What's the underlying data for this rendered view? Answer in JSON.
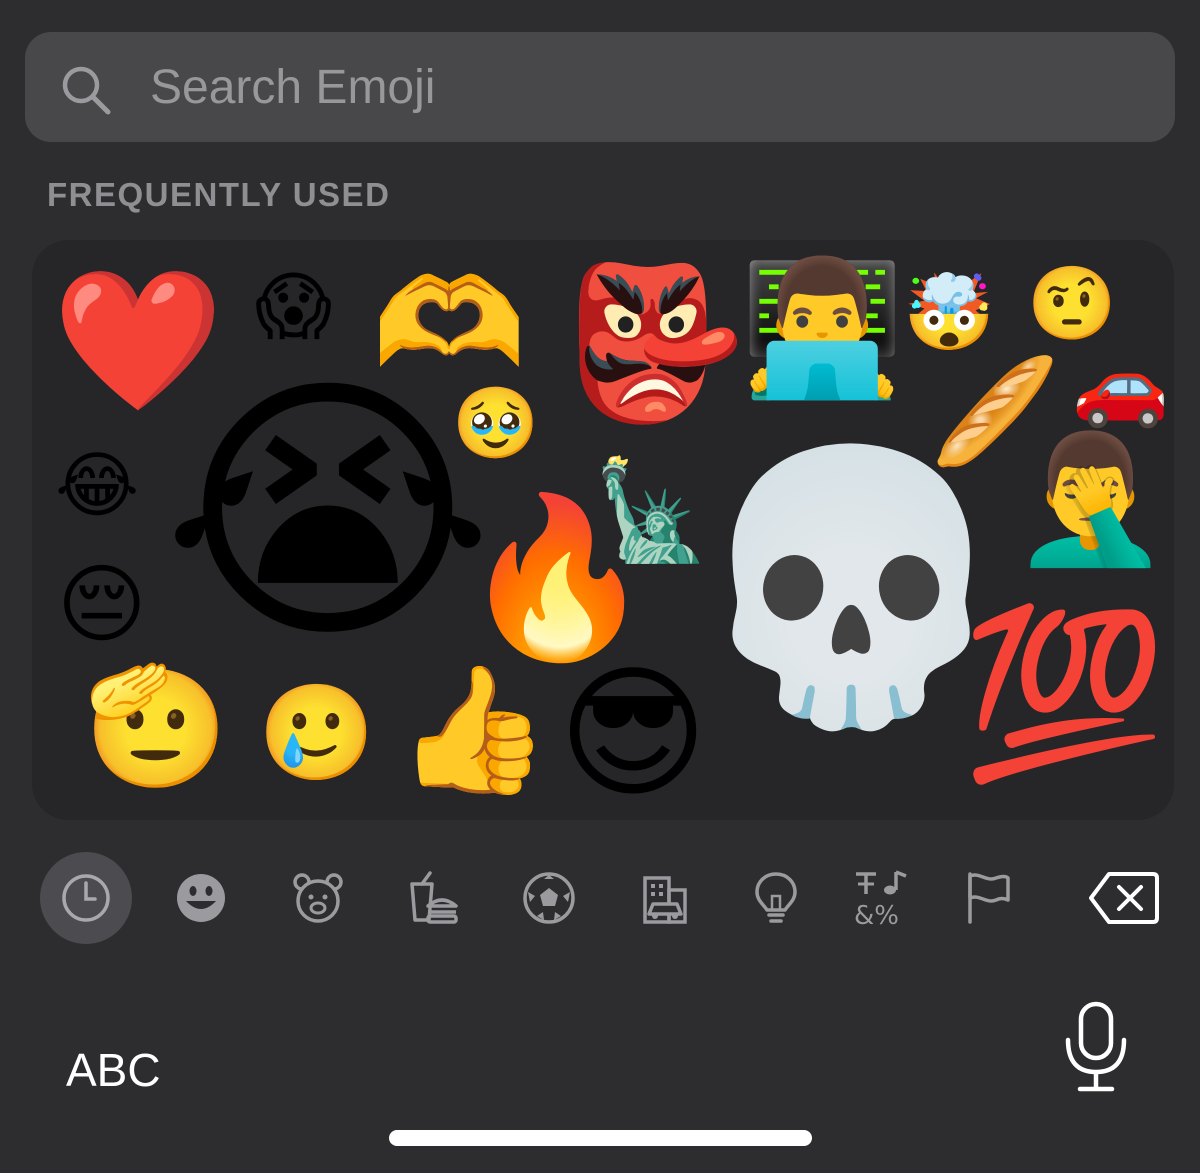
{
  "search": {
    "placeholder": "Search Emoji",
    "icon": "search-icon"
  },
  "section": {
    "title": "FREQUENTLY USED"
  },
  "emojis": [
    {
      "name": "red-heart",
      "char": "❤️"
    },
    {
      "name": "face-screaming-in-fear",
      "char": "😱"
    },
    {
      "name": "heart-hands",
      "char": "🫶"
    },
    {
      "name": "goblin",
      "char": "👺"
    },
    {
      "name": "man-technologist",
      "char": "👨‍💻"
    },
    {
      "name": "exploding-head",
      "char": "🤯"
    },
    {
      "name": "face-with-raised-eyebrow",
      "char": "🤨"
    },
    {
      "name": "automobile",
      "char": "🚗"
    },
    {
      "name": "baguette-bread",
      "char": "🥖"
    },
    {
      "name": "loudly-crying-face",
      "char": "😭"
    },
    {
      "name": "pleading-face",
      "char": "🥹"
    },
    {
      "name": "face-with-tears-of-joy",
      "char": "😂"
    },
    {
      "name": "statue-of-liberty",
      "char": "🗽"
    },
    {
      "name": "man-facepalming",
      "char": "🤦‍♂️"
    },
    {
      "name": "skull",
      "char": "💀"
    },
    {
      "name": "fire",
      "char": "🔥"
    },
    {
      "name": "pensive-face",
      "char": "😔"
    },
    {
      "name": "hundred-points",
      "char": "💯"
    },
    {
      "name": "saluting-face",
      "char": "🫡"
    },
    {
      "name": "face-holding-back-tears",
      "char": "🥲"
    },
    {
      "name": "thumbs-up",
      "char": "👍"
    },
    {
      "name": "smiling-face-with-sunglasses",
      "char": "😎"
    }
  ],
  "categories": [
    {
      "name": "recents-clock-icon",
      "active": true
    },
    {
      "name": "smileys-face-icon",
      "active": false
    },
    {
      "name": "animals-bear-icon",
      "active": false
    },
    {
      "name": "food-drink-icon",
      "active": false
    },
    {
      "name": "activity-soccer-ball-icon",
      "active": false
    },
    {
      "name": "travel-building-car-icon",
      "active": false
    },
    {
      "name": "objects-lightbulb-icon",
      "active": false
    },
    {
      "name": "symbols-icon",
      "active": false
    },
    {
      "name": "flags-icon",
      "active": false
    },
    {
      "name": "delete-backspace-icon",
      "active": false
    }
  ],
  "bottom": {
    "abc_label": "ABC",
    "mic_icon": "microphone-icon"
  },
  "colors": {
    "background": "#2d2d2f",
    "search_field": "#48484b",
    "panel": "#262628",
    "secondary_text": "#8e8e93",
    "icon": "#9a9a9f",
    "active_category": "#4c4c50"
  }
}
